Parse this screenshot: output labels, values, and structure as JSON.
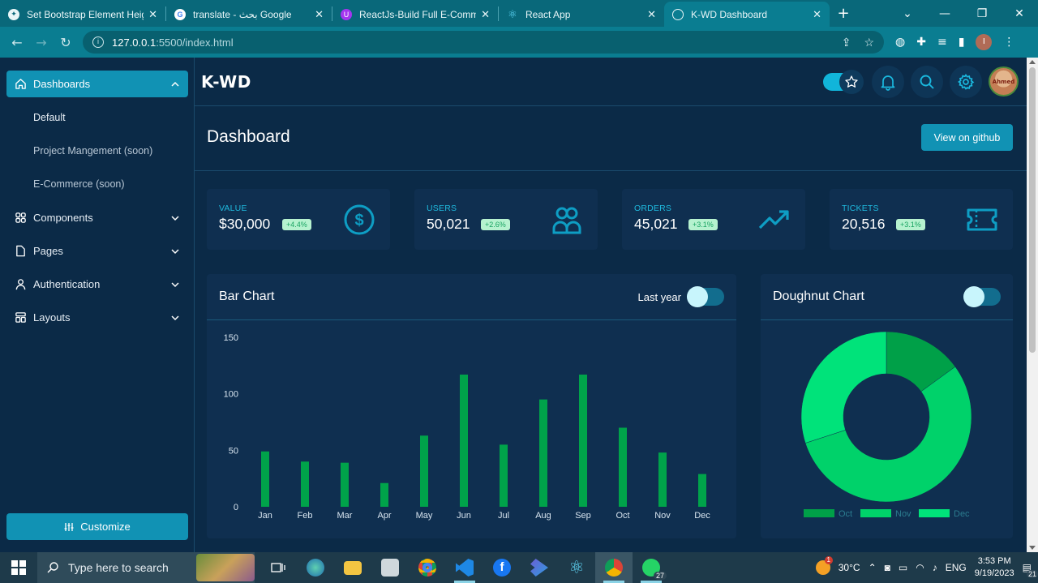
{
  "browser": {
    "tabs": [
      {
        "title": "Set Bootstrap Element Height",
        "icon": "chatgpt-icon"
      },
      {
        "title": "translate - بحث Google",
        "icon": "google-icon"
      },
      {
        "title": "ReactJs-Build Full E-Commerce",
        "icon": "udemy-icon"
      },
      {
        "title": "React App",
        "icon": "react-icon"
      },
      {
        "title": "K-WD Dashboard",
        "icon": "globe-icon",
        "active": true
      }
    ],
    "url_host": "127.0.0.1",
    "url_path": ":5500/index.html"
  },
  "app": {
    "brand": "K-WD",
    "sidebar": {
      "items": [
        {
          "label": "Dashboards",
          "icon": "home-icon",
          "expanded": true
        },
        {
          "label": "Components",
          "icon": "grid-icon"
        },
        {
          "label": "Pages",
          "icon": "file-icon"
        },
        {
          "label": "Authentication",
          "icon": "user-icon"
        },
        {
          "label": "Layouts",
          "icon": "layout-icon"
        }
      ],
      "sub_items": [
        "Default",
        "Project Mangement (soon)",
        "E-Commerce (soon)"
      ],
      "customize_label": "Customize"
    },
    "header": {
      "title": "Dashboard",
      "github_label": "View on github"
    },
    "stats": [
      {
        "label": "VALUE",
        "value": "$30,000",
        "change": "+4.4%",
        "icon": "dollar-icon"
      },
      {
        "label": "USERS",
        "value": "50,021",
        "change": "+2.6%",
        "icon": "users-icon"
      },
      {
        "label": "ORDERS",
        "value": "45,021",
        "change": "+3.1%",
        "icon": "trending-up-icon"
      },
      {
        "label": "TICKETS",
        "value": "20,516",
        "change": "+3.1%",
        "icon": "ticket-icon"
      }
    ],
    "bar_card": {
      "title": "Bar Chart",
      "toggle_label": "Last year"
    },
    "doughnut_card": {
      "title": "Doughnut Chart"
    },
    "colors": {
      "accent": "#1192b4",
      "bar": "#00a34a",
      "doughnut_dark": "#00a048",
      "doughnut_mid": "#00d26a",
      "doughnut_light": "#00e37a"
    }
  },
  "chart_data": [
    {
      "type": "bar",
      "categories": [
        "Jan",
        "Feb",
        "Mar",
        "Apr",
        "May",
        "Jun",
        "Jul",
        "Aug",
        "Sep",
        "Oct",
        "Nov",
        "Dec"
      ],
      "values": [
        49,
        40,
        39,
        21,
        63,
        117,
        55,
        95,
        117,
        70,
        48,
        29
      ],
      "ylim": [
        0,
        150
      ],
      "yticks": [
        0,
        50,
        100,
        150
      ],
      "grid": false
    },
    {
      "type": "pie",
      "categories": [
        "Oct",
        "Nov",
        "Dec"
      ],
      "values": [
        15,
        55,
        30
      ],
      "legend": "bottom"
    }
  ],
  "taskbar": {
    "search_placeholder": "Type here to search",
    "temperature": "30°C",
    "language": "ENG",
    "time": "3:53 PM",
    "date": "9/19/2023",
    "whatsapp_badge": "27",
    "notification_count": "21",
    "weather_badge": "1"
  }
}
